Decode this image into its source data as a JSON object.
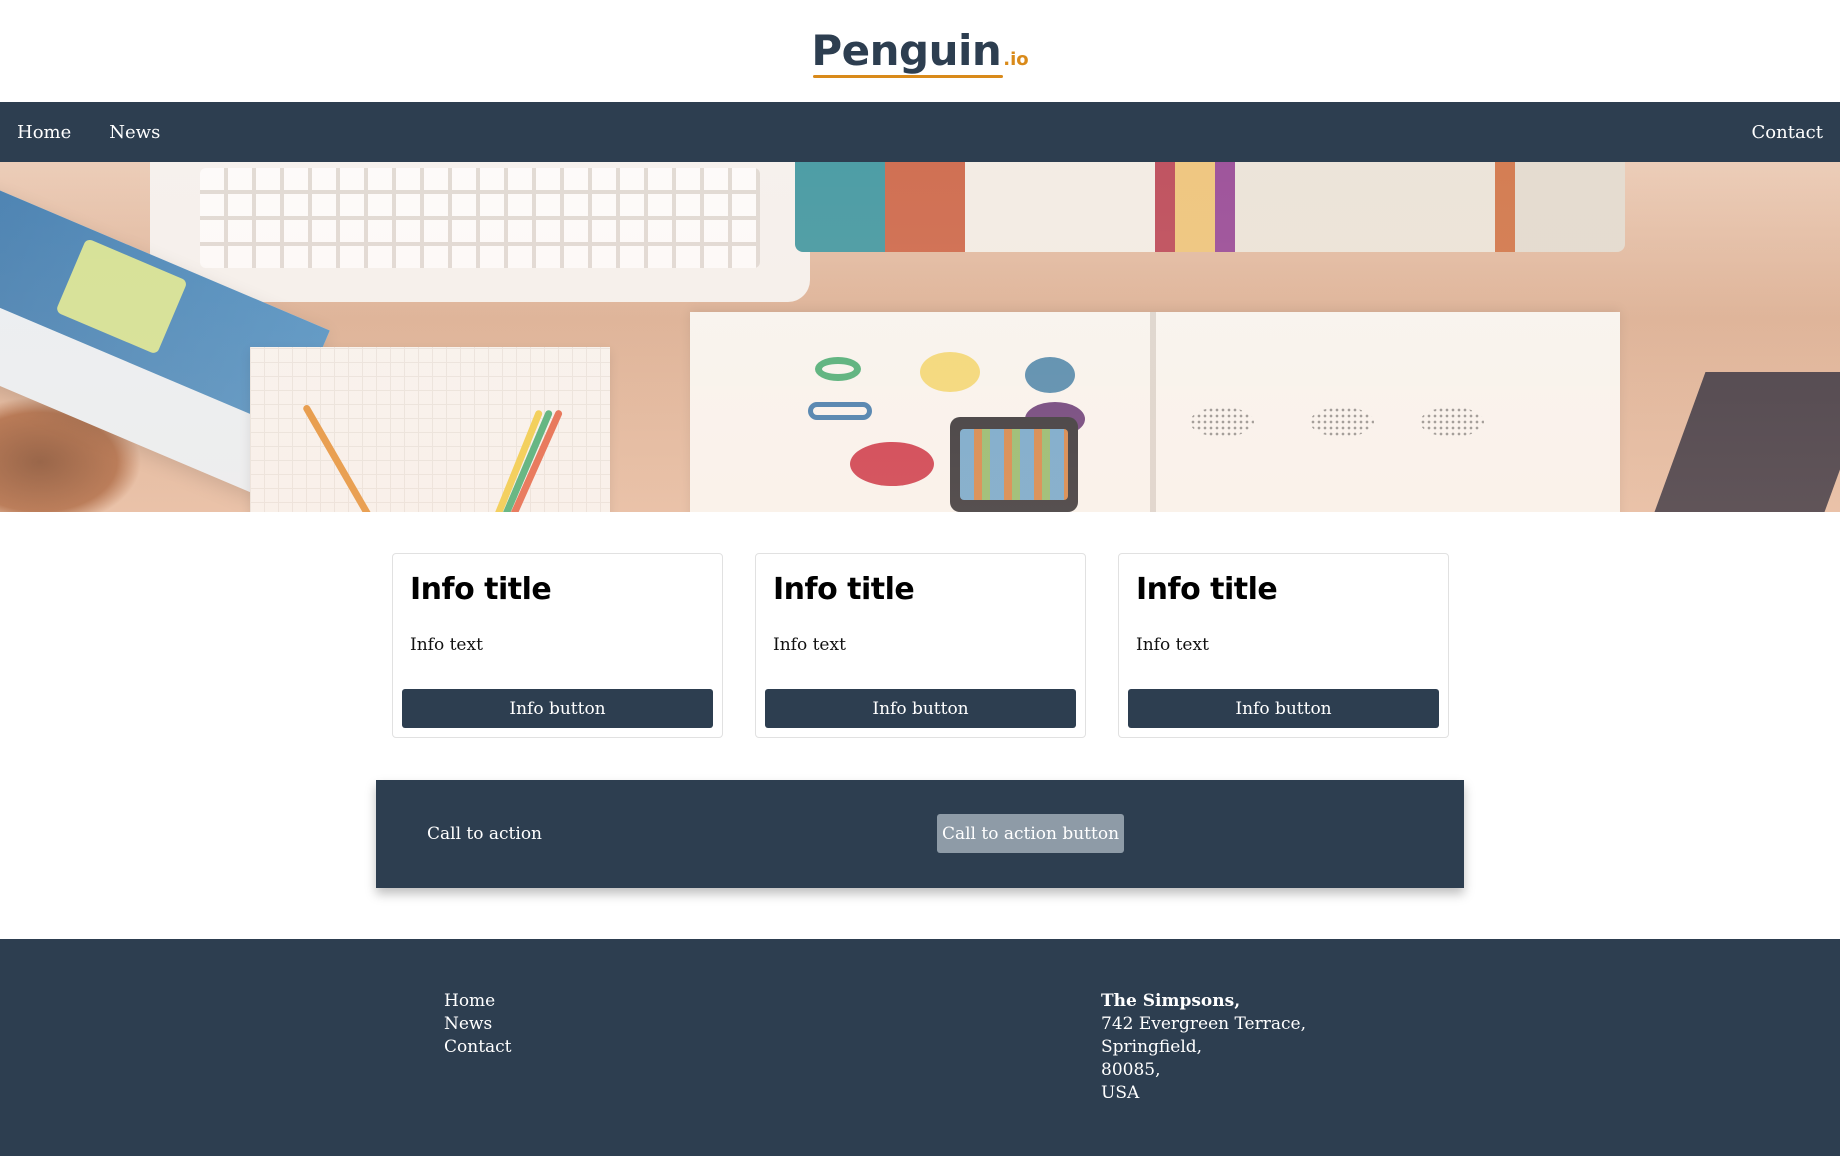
{
  "logo": {
    "main": "Penguin",
    "suffix": ".io"
  },
  "nav": {
    "items": [
      "Home",
      "News"
    ],
    "right": "Contact"
  },
  "cards": [
    {
      "title": "Info title",
      "text": "Info text",
      "button": "Info button"
    },
    {
      "title": "Info title",
      "text": "Info text",
      "button": "Info button"
    },
    {
      "title": "Info title",
      "text": "Info text",
      "button": "Info button"
    }
  ],
  "cta": {
    "text": "Call to action",
    "button": "Call to action button"
  },
  "footer": {
    "links": [
      "Home",
      "News",
      "Contact"
    ],
    "address": {
      "name": "The Simpsons,",
      "lines": [
        "742 Evergreen Terrace,",
        "Springfield,",
        "80085,",
        "USA"
      ]
    }
  },
  "colors": {
    "primary": "#2d3e50",
    "accent": "#d98a1a",
    "cta_button": "#8e9ba7"
  }
}
